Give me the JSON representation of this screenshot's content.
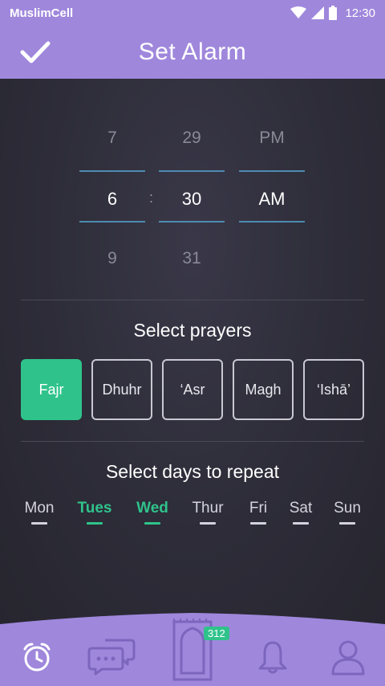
{
  "status_bar": {
    "carrier": "MuslimCell",
    "time": "12:30"
  },
  "header": {
    "title": "Set Alarm",
    "confirm_icon": "checkmark-icon"
  },
  "time_picker": {
    "hour": {
      "prev": "7",
      "selected": "6",
      "next": "9"
    },
    "separator": ":",
    "minute": {
      "prev": "29",
      "selected": "30",
      "next": "31"
    },
    "period": {
      "prev": "PM",
      "selected": "AM"
    }
  },
  "prayers": {
    "title": "Select prayers",
    "items": [
      {
        "label": "Fajr",
        "active": true
      },
      {
        "label": "Dhuhr",
        "active": false
      },
      {
        "label": "‘Asr",
        "active": false
      },
      {
        "label": "Magh",
        "active": false
      },
      {
        "label": "‘Ishā’",
        "active": false
      }
    ]
  },
  "days": {
    "title": "Select days to repeat",
    "items": [
      {
        "label": "Mon",
        "active": false
      },
      {
        "label": "Tues",
        "active": true
      },
      {
        "label": "Wed",
        "active": true
      },
      {
        "label": "Thur",
        "active": false
      },
      {
        "label": "Fri",
        "active": false
      },
      {
        "label": "Sat",
        "active": false
      },
      {
        "label": "Sun",
        "active": false
      }
    ]
  },
  "bottom_nav": {
    "items": [
      "alarm-clock-icon",
      "chat-bubbles-icon",
      "prayer-mat-icon",
      "bell-icon",
      "profile-icon"
    ],
    "badge": "312"
  },
  "colors": {
    "accent_purple": "#9f87dc",
    "accent_green": "#2fc38b",
    "background": "#2b2a36"
  }
}
